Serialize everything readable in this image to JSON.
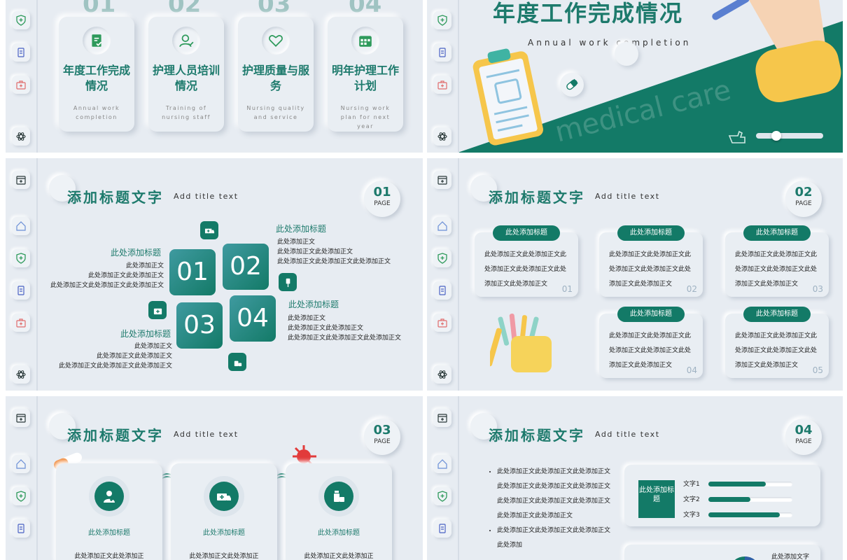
{
  "colors": {
    "accent": "#137a67",
    "background": "#e7ecf2",
    "title": "#1d7a6c"
  },
  "slide1": {
    "numbers": [
      "01",
      "02",
      "03",
      "04"
    ],
    "cards": [
      {
        "title": "年度工作完成情况",
        "subtitle": "Annual work completion",
        "icon": "document-check-icon"
      },
      {
        "title": "护理人员培训情况",
        "subtitle": "Training of nursing staff",
        "icon": "user-check-icon"
      },
      {
        "title": "护理质量与服务",
        "subtitle": "Nursing quality and service",
        "icon": "heart-stethoscope-icon"
      },
      {
        "title": "明年护理工作计划",
        "subtitle": "Nursing work plan for next year",
        "icon": "calendar-icon"
      }
    ]
  },
  "slide2": {
    "title": "年度工作完成情况",
    "subtitle": "Annual work completion",
    "watermark": "medical care"
  },
  "slide3": {
    "title_cn": "添加标题文字",
    "title_en": "Add title text",
    "page_num": "01",
    "page_label": "PAGE",
    "squares": [
      "01",
      "02",
      "03",
      "04"
    ],
    "blocks": [
      {
        "title": "此处添加标题",
        "lines": [
          "此处添加正文",
          "此处添加正文此处添加正文",
          "此处添加正文此处添加正文此处添加正文"
        ]
      },
      {
        "title": "此处添加标题",
        "lines": [
          "此处添加正文",
          "此处添加正文此处添加正文",
          "此处添加正文此处添加正文此处添加正文"
        ]
      },
      {
        "title": "此处添加标题",
        "lines": [
          "此处添加正文",
          "此处添加正文此处添加正文",
          "此处添加正文此处添加正文此处添加正文"
        ]
      },
      {
        "title": "此处添加标题",
        "lines": [
          "此处添加正文",
          "此处添加正文此处添加正文",
          "此处添加正文此处添加正文此处添加正文"
        ]
      }
    ]
  },
  "slide4": {
    "title_cn": "添加标题文字",
    "title_en": "Add title text",
    "page_num": "02",
    "page_label": "PAGE",
    "boxes": [
      {
        "label": "此处添加标题",
        "text": "此处添加正文此处添加正文此处添加正文此处添加正文此处添加正文此处添加正文",
        "num": "01"
      },
      {
        "label": "此处添加标题",
        "text": "此处添加正文此处添加正文此处添加正文此处添加正文此处添加正文此处添加正文",
        "num": "02"
      },
      {
        "label": "此处添加标题",
        "text": "此处添加正文此处添加正文此处添加正文此处添加正文此处添加正文此处添加正文",
        "num": "03"
      },
      {
        "label": "此处添加标题",
        "text": "此处添加正文此处添加正文此处添加正文此处添加正文此处添加正文此处添加正文",
        "num": "04"
      },
      {
        "label": "此处添加标题",
        "text": "此处添加正文此处添加正文此处添加正文此处添加正文此处添加正文此处添加正文",
        "num": "05"
      }
    ]
  },
  "slide5": {
    "title_cn": "添加标题文字",
    "title_en": "Add title text",
    "page_num": "03",
    "page_label": "PAGE",
    "cards": [
      {
        "title": "此处添加标题",
        "body": "此处添加正文此处添加正",
        "icon": "doctor-icon"
      },
      {
        "title": "此处添加标题",
        "body": "此处添加正文此处添加正",
        "icon": "ambulance-icon"
      },
      {
        "title": "此处添加标题",
        "body": "此处添加正文此处添加正",
        "icon": "medicine-icon"
      }
    ]
  },
  "slide6": {
    "title_cn": "添加标题文字",
    "title_en": "Add title text",
    "page_num": "04",
    "page_label": "PAGE",
    "bullets": [
      "此处添加正文此处添加正文此处添加正文此处添加正文此处添加正文此处添加正文此处添加正文此处添加正文此处添加正文此处添加正文此处添加正文",
      "此处添加正文此处添加正文此处添加正文此处添加"
    ],
    "box_label": "此处添加标题",
    "bars": [
      {
        "label": "文字1",
        "value": 0.68
      },
      {
        "label": "文字2",
        "value": 0.5
      },
      {
        "label": "文字3",
        "value": 0.85
      }
    ],
    "footer_label": "此处添加文字"
  }
}
